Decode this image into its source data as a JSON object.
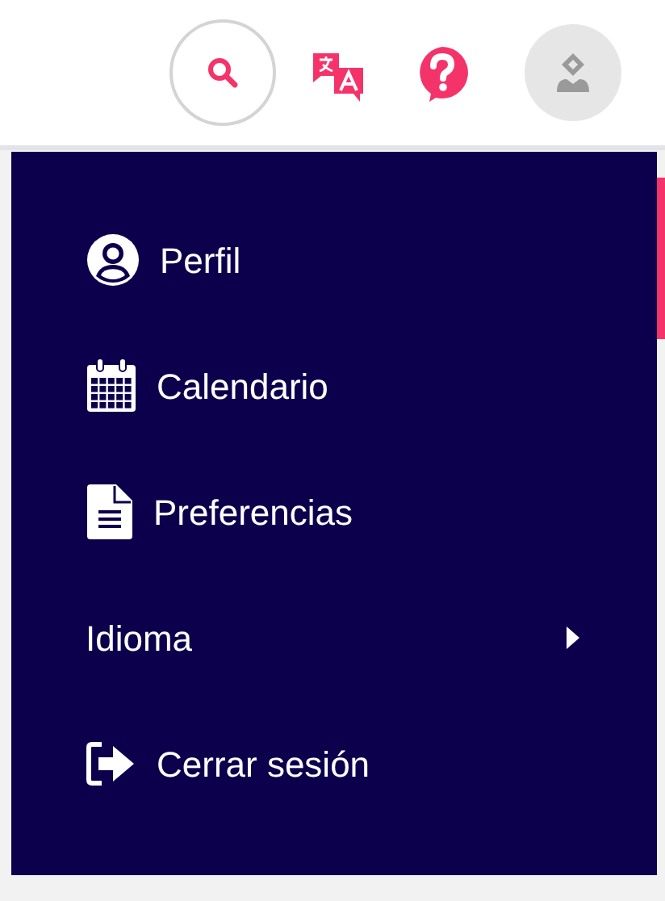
{
  "menu": {
    "items": [
      {
        "kind": "link",
        "label": "Perfil"
      },
      {
        "kind": "link",
        "label": "Calendario"
      },
      {
        "kind": "link",
        "label": "Preferencias"
      },
      {
        "kind": "submenu",
        "label": "Idioma"
      },
      {
        "kind": "link",
        "label": "Cerrar sesión"
      }
    ]
  }
}
